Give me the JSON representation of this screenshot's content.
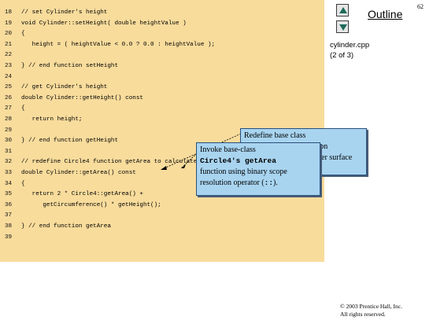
{
  "page_number": "62",
  "sidebar": {
    "title": "Outline",
    "file_name": "cylinder.cpp",
    "file_part": "(2 of 3)",
    "nav_up_icon": "up-arrow-icon",
    "nav_down_icon": "down-arrow-icon"
  },
  "code": [
    {
      "num": "18",
      "text": "// set Cylinder's height"
    },
    {
      "num": "19",
      "text": "void Cylinder::setHeight( double heightValue )"
    },
    {
      "num": "20",
      "text": "{"
    },
    {
      "num": "21",
      "text": "   height = ( heightValue < 0.0 ? 0.0 : heightValue );"
    },
    {
      "num": "22",
      "text": ""
    },
    {
      "num": "23",
      "text": "} // end function setHeight"
    },
    {
      "num": "24",
      "text": ""
    },
    {
      "num": "25",
      "text": "// get Cylinder's height"
    },
    {
      "num": "26",
      "text": "double Cylinder::getHeight() const"
    },
    {
      "num": "27",
      "text": "{"
    },
    {
      "num": "28",
      "text": "   return height;"
    },
    {
      "num": "29",
      "text": ""
    },
    {
      "num": "30",
      "text": "} // end function getHeight"
    },
    {
      "num": "31",
      "text": ""
    },
    {
      "num": "32",
      "text": "// redefine Circle4 function getArea to calculate Cylinder area"
    },
    {
      "num": "33",
      "text": "double Cylinder::getArea() const"
    },
    {
      "num": "34",
      "text": "{"
    },
    {
      "num": "35",
      "text": "   return 2 * Circle4::getArea() +"
    },
    {
      "num": "36",
      "text": "      getCircumference() * getHeight();"
    },
    {
      "num": "37",
      "text": ""
    },
    {
      "num": "38",
      "text": "} // end function getArea"
    },
    {
      "num": "39",
      "text": ""
    }
  ],
  "callouts": {
    "back": {
      "line1": "Redefine base class",
      "line2": "Circle4's member function",
      "line3": "getArea to return Cylinder surface area."
    },
    "front": {
      "line1": "Invoke base-class",
      "line2_code": "Circle4's getArea",
      "line3": "function using binary scope",
      "line4_prefix": "resolution operator (",
      "line4_code": "::",
      "line4_suffix": ")."
    }
  },
  "copyright": {
    "line1": "© 2003 Prentice Hall, Inc.",
    "line2": "All rights reserved."
  }
}
